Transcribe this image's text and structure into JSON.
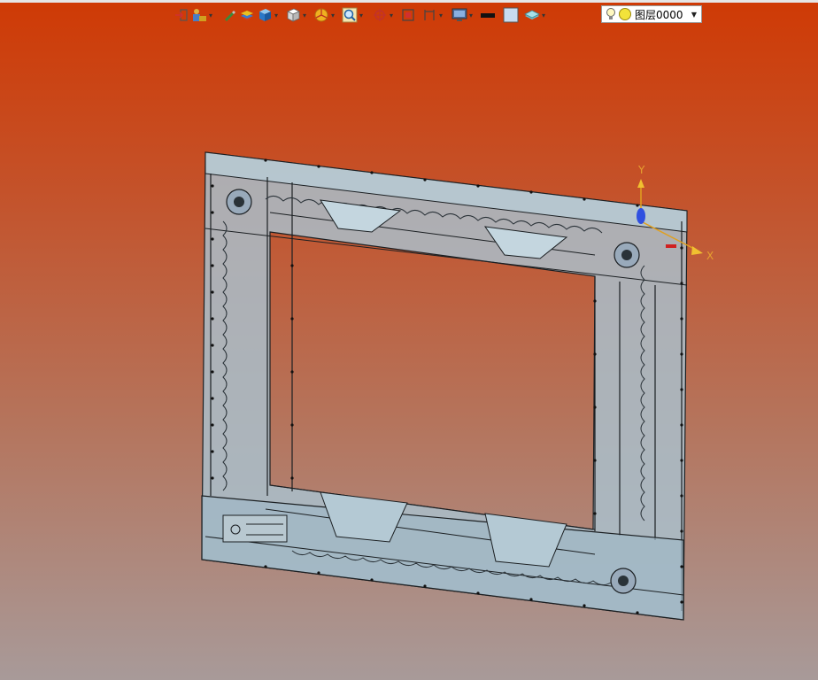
{
  "window": {
    "app": "CAD 3D viewport"
  },
  "toolbar": {
    "tools": [
      {
        "icon": "exit-sketch-icon",
        "has_menu": false
      },
      {
        "icon": "user-part-icon",
        "has_menu": true
      },
      {
        "icon": "pencil-icon",
        "has_menu": false
      },
      {
        "icon": "stack-layers-icon",
        "has_menu": false
      },
      {
        "icon": "solid-cube-icon",
        "has_menu": true
      },
      {
        "icon": "view-cube-icon",
        "has_menu": true
      },
      {
        "icon": "pie-render-icon",
        "has_menu": true
      },
      {
        "icon": "zoom-fit-icon",
        "has_menu": true
      },
      {
        "icon": "snap-target-icon",
        "has_menu": true
      },
      {
        "icon": "section-view-icon",
        "has_menu": false
      },
      {
        "icon": "dimension-icon",
        "has_menu": true
      },
      {
        "icon": "monitor-icon",
        "has_menu": true
      },
      {
        "icon": "line-color-icon",
        "has_menu": false
      },
      {
        "icon": "fill-color-icon",
        "has_menu": false
      },
      {
        "icon": "layer-visibility-icon",
        "has_menu": true
      }
    ],
    "layer_select": {
      "value": "图层0000"
    }
  },
  "axes": {
    "x_label": "X",
    "y_label": "Y"
  },
  "colors": {
    "bg_top": "#cf3a05",
    "bg_bottom": "#a89a99",
    "model_fill": "#9ab6c4",
    "edge": "#1b1f22"
  }
}
